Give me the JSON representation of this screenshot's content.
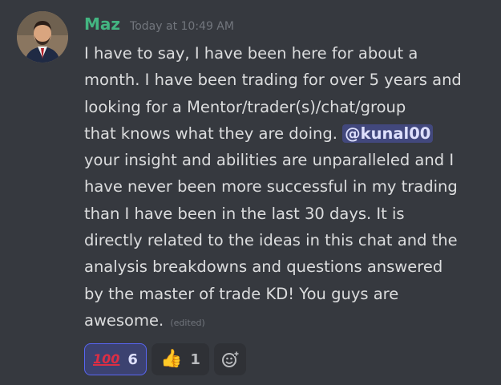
{
  "message": {
    "username": "Maz",
    "timestamp": "Today at 10:49 AM",
    "lines": [
      "I have to say, I have been here for about a",
      "month. I have been trading for over 5 years and",
      "looking for a Mentor/trader(s)/chat/group",
      "that knows what they are doing. ",
      "your insight and abilities are unparalleled and I",
      "have never been more successful in my trading",
      "than I have been in the last 30 days. It is",
      "directly related to the ideas in this chat and the",
      "analysis breakdowns and questions answered",
      "by the master of trade KD! You guys are",
      "awesome. "
    ],
    "mention": "@kunal00",
    "edited_label": "(edited)"
  },
  "reactions": [
    {
      "emoji": "hundred-points-icon",
      "glyph": "100",
      "count": "6",
      "active": true
    },
    {
      "emoji": "thumbs-up-icon",
      "glyph": "👍",
      "count": "1",
      "active": false
    }
  ],
  "colors": {
    "background": "#36393f",
    "username": "#43b581",
    "mention_bg": "#4b5bb4",
    "reaction_active_border": "#5865f2"
  }
}
